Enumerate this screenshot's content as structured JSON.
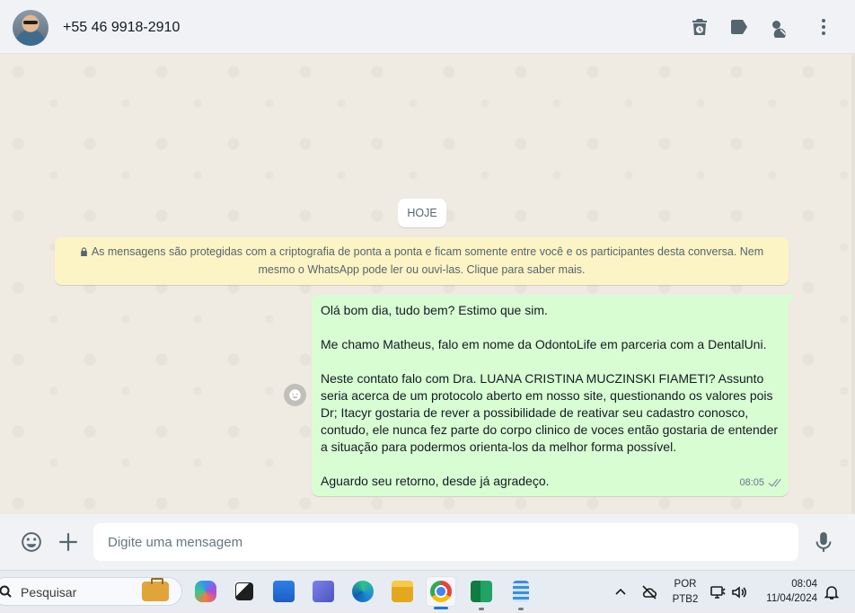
{
  "header": {
    "contact_name": "+55 46 9918-2910",
    "icons": [
      "trash-clock-icon",
      "label-icon",
      "search-icon",
      "menu-icon"
    ]
  },
  "chat": {
    "date_divider": "HOJE",
    "encryption_notice": "As mensagens são protegidas com a criptografia de ponta a ponta e ficam somente entre você e os participantes desta conversa. Nem mesmo o WhatsApp pode ler ou ouvi-las. Clique para saber mais.",
    "message": {
      "paragraphs": [
        "Olá bom dia, tudo bem? Estimo que sim.",
        "Me chamo Matheus, falo em nome da OdontoLife em parceria com a DentalUni.",
        "Neste contato falo com Dra. LUANA CRISTINA MUCZINSKI FIAMETI? Assunto seria acerca de um protocolo aberto em nosso site, questionando os valores pois Dr; Itacyr gostaria de rever a possibilidade de reativar seu cadastro conosco, contudo, ele nunca fez parte do corpo clinico de voces então gostaria de entender a situação para podermos orienta-los da melhor forma possível.",
        "Aguardo seu retorno, desde já agradeço."
      ],
      "time": "08:05",
      "status": "delivered"
    }
  },
  "composer": {
    "placeholder": "Digite uma mensagem"
  },
  "taskbar": {
    "search_label": "Pesquisar",
    "language": "POR",
    "layout": "PTB2",
    "time": "08:04",
    "date": "11/04/2024",
    "apps": [
      "copilot",
      "task-view",
      "store",
      "teams",
      "edge",
      "file-explorer",
      "chrome",
      "excel",
      "notepad"
    ]
  },
  "colors": {
    "outgoing_bubble": "#d9fdd3",
    "encryption_bg": "#fdf4c5",
    "chat_bg": "#efeae2",
    "header_bg": "#f0f2f5",
    "icon_gray": "#54656f"
  }
}
